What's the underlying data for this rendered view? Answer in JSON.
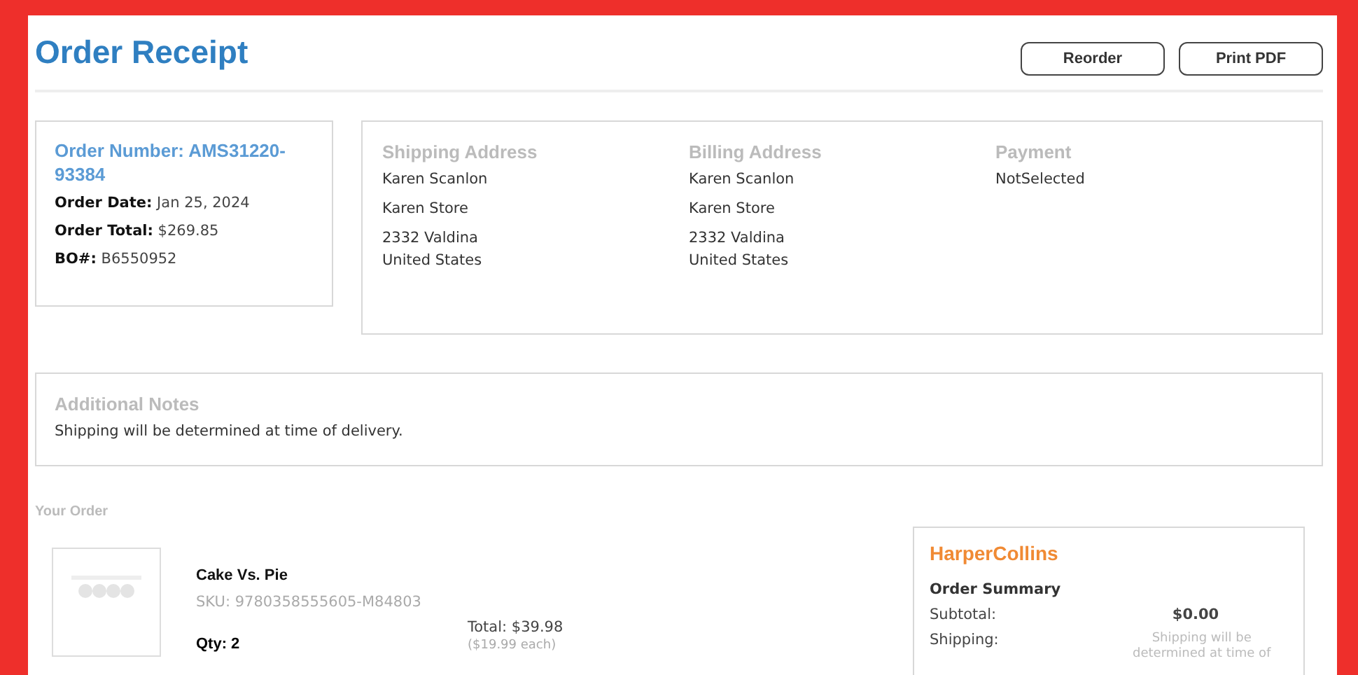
{
  "title": "Order Receipt",
  "buttons": [
    "Reorder",
    "Print PDF"
  ],
  "order": {
    "number": "Order Number: AMS31220-93384",
    "fields": [
      {
        "label": "Order Date:",
        "value": "Jan 25, 2024"
      },
      {
        "label": "Order Total:",
        "value": "$269.85"
      },
      {
        "label": "BO#:",
        "value": "B6550952"
      }
    ]
  },
  "addresses": [
    {
      "heading": "Shipping Address",
      "lines": [
        "Karen Scanlon",
        "Karen Store",
        "2332 Valdina\nUnited States"
      ]
    },
    {
      "heading": "Billing Address",
      "lines": [
        "Karen Scanlon",
        "Karen Store",
        "2332 Valdina\nUnited States"
      ]
    },
    {
      "heading": "Payment",
      "lines": [
        "NotSelected"
      ]
    }
  ],
  "notes": {
    "heading": "Additional Notes",
    "text": "Shipping will be determined at time of delivery."
  },
  "your_order": "Your Order",
  "items": [
    {
      "kind": "picture",
      "name": "Cake Vs. Pie",
      "sku": "SKU: 9780358555605-M84803",
      "qty": "Qty: 2",
      "total": "Total: $39.98",
      "each": "($19.99 each)"
    }
  ],
  "summary": {
    "publisher": "HarperCollins",
    "heading": "Order Summary",
    "rows": [
      {
        "label": "Subtotal:",
        "value": "$0.00",
        "kind": "amount"
      },
      {
        "label": "Shipping:",
        "value": "Shipping will be determined at time of",
        "kind": "note"
      }
    ]
  }
}
